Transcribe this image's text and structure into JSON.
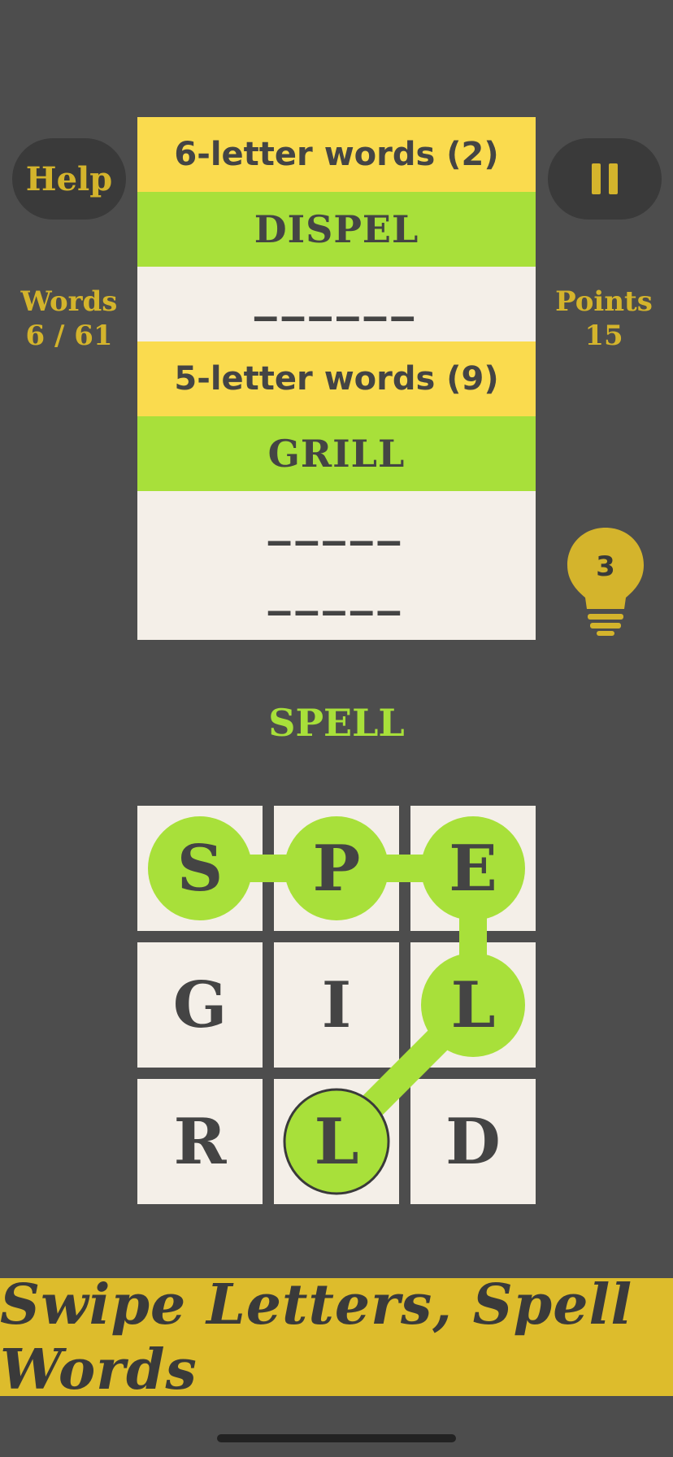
{
  "buttons": {
    "help_label": "Help",
    "pause_icon": "pause-icon"
  },
  "stats": {
    "words_label": "Words",
    "words_value": "6 / 61",
    "points_label": "Points",
    "points_value": "15"
  },
  "hint": {
    "count": "3",
    "icon": "lightbulb-icon"
  },
  "word_list": {
    "six_header": "6-letter words (2)",
    "six_found": "DISPEL",
    "six_blank": "––––––",
    "five_header": "5-letter words (9)",
    "five_found": "GRILL",
    "five_blank_1": "–––––",
    "five_blank_2": "–––––"
  },
  "current_word": "SPELL",
  "grid": {
    "letters": [
      "S",
      "P",
      "E",
      "G",
      "I",
      "L",
      "R",
      "L",
      "D"
    ],
    "path": [
      0,
      1,
      2,
      5,
      7
    ]
  },
  "banner": "Swipe Letters, Spell Words",
  "colors": {
    "background": "#4d4d4d",
    "accent_yellow": "#fadb4e",
    "found_green": "#a8e03a",
    "gold": "#d4b42c",
    "tile": "#f4efe8"
  }
}
